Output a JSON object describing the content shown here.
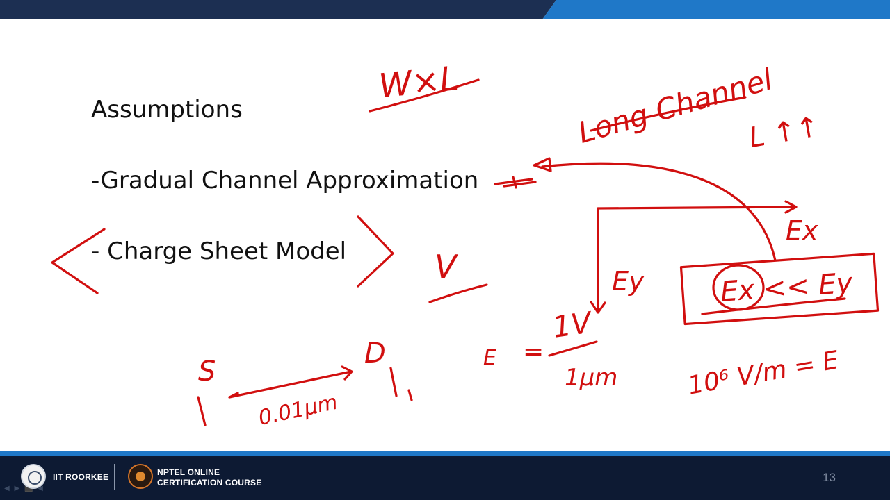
{
  "slide": {
    "lines": [
      "Assumptions",
      "-Gradual Channel Approximation",
      "- Charge Sheet Model"
    ],
    "page_number": "13"
  },
  "annotations": {
    "top_formula": "W×L",
    "long_channel": "Long Channel",
    "length_note": "L ↑↑",
    "field_x": "Ex",
    "field_y": "Ey",
    "inequality": "Ex << Ey",
    "voltage": "V",
    "source": "S",
    "drain": "D",
    "distance": "0.01μm",
    "field_numerator": "1V",
    "field_denominator": "1μm",
    "field_symbol": "E",
    "field_value": "10⁶ V/m = E"
  },
  "footer": {
    "institute": "IIT ROORKEE",
    "program_line1": "NPTEL ONLINE",
    "program_line2": "CERTIFICATION COURSE"
  },
  "colors": {
    "ink": "#d10f0f",
    "footer_bg": "#0d1a33",
    "accent": "#1f78c8"
  }
}
